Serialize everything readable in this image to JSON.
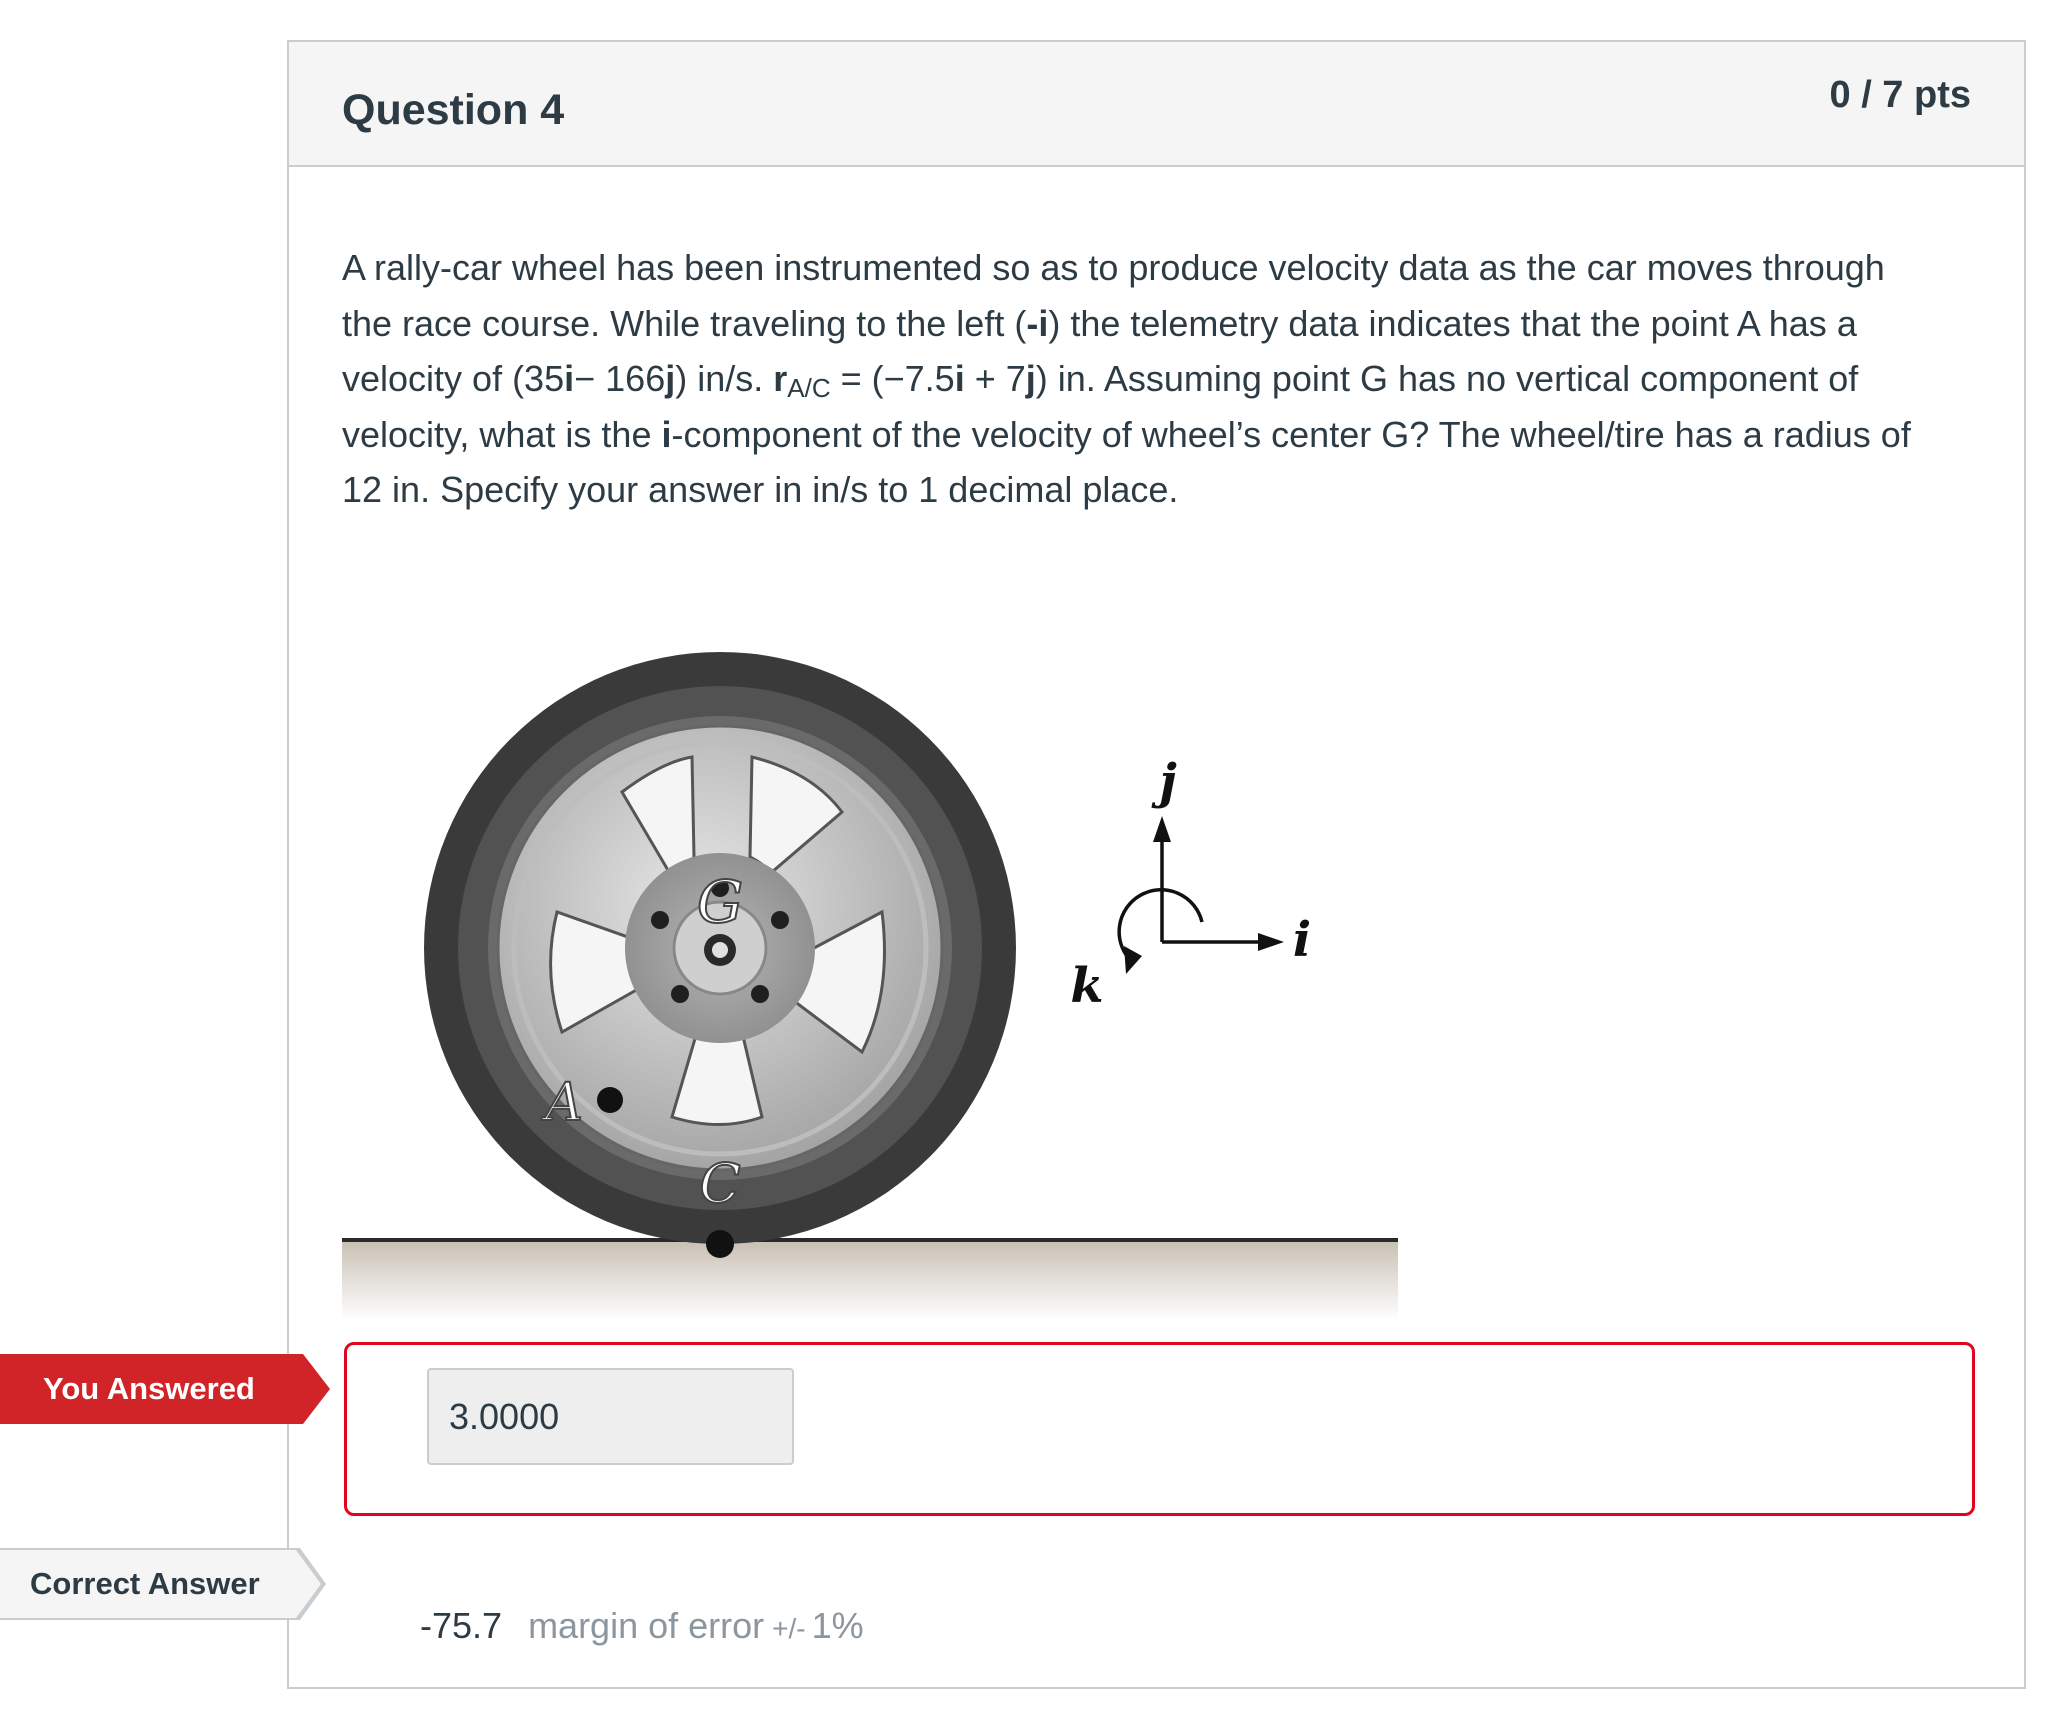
{
  "question": {
    "title": "Question 4",
    "points": "0 / 7 pts",
    "text": {
      "line1": "A rally-car wheel has been instrumented so as to produce velocity data as the car moves through",
      "line2_a": "the race course. While traveling to the left (",
      "line2_b": "-i",
      "line2_c": ") the telemetry data indicates that the point A has a",
      "line3_a": "velocity of (35",
      "line3_b": "i",
      "line3_c": "− 166",
      "line3_d": "j",
      "line3_e": ") in/s. ",
      "line3_f": "r",
      "line3_g": "A/C",
      "line3_h": " = (−7.5",
      "line3_i": "i",
      "line3_j": " + 7",
      "line3_k": "j",
      "line3_l": ") in. Assuming point G has no vertical component of",
      "line4_a": "velocity, what is the ",
      "line4_b": "i",
      "line4_c": "-component of the velocity of wheel’s center G? The wheel/tire has a radius of",
      "line5": "12 in. Specify your answer in in/s to 1 decimal place."
    }
  },
  "figure": {
    "point_labels": {
      "G": "G",
      "A": "A",
      "C": "C"
    },
    "axis_labels": {
      "i": "i",
      "j": "j",
      "k": "k"
    }
  },
  "answer": {
    "you_answered_label": "You Answered",
    "value": "3.0000",
    "correct_label": "Correct Answer",
    "correct_value": "-75.7",
    "margin_text": "margin of error",
    "margin_pm": "+/-",
    "margin_pct": "1%"
  },
  "colors": {
    "wrong_red": "#e0061f",
    "flag_red": "#d12428",
    "text": "#2d3b45",
    "muted": "#8b969e"
  }
}
